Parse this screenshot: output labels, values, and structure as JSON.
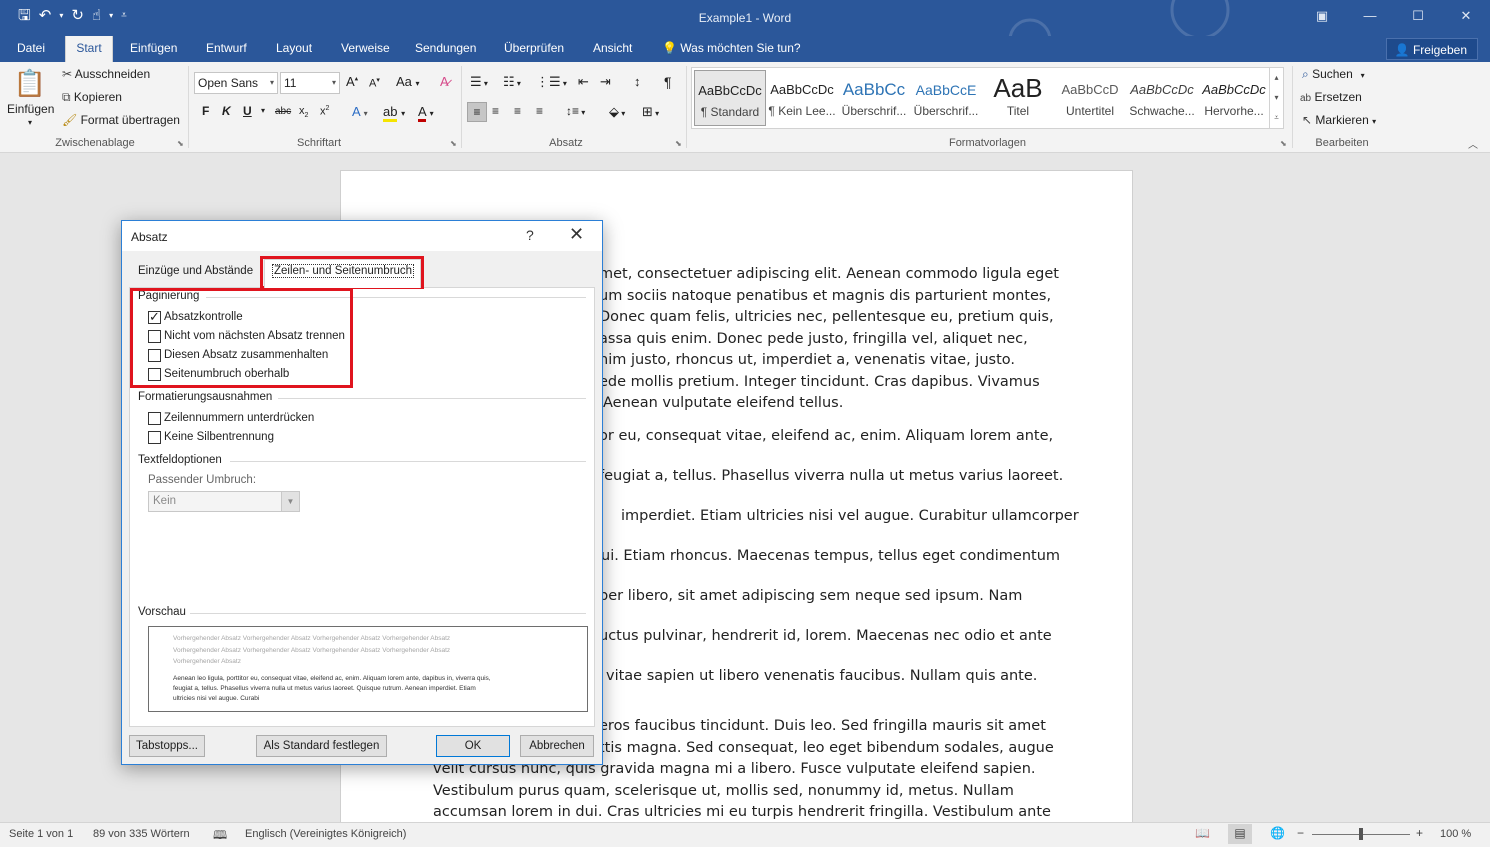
{
  "window": {
    "title": "Example1 - Word",
    "share_label": "Freigeben"
  },
  "tabs": [
    {
      "label": "Datei"
    },
    {
      "label": "Start"
    },
    {
      "label": "Einfügen"
    },
    {
      "label": "Entwurf"
    },
    {
      "label": "Layout"
    },
    {
      "label": "Verweise"
    },
    {
      "label": "Sendungen"
    },
    {
      "label": "Überprüfen"
    },
    {
      "label": "Ansicht"
    },
    {
      "label": "Was möchten Sie tun?"
    }
  ],
  "ribbon": {
    "clipboard": {
      "label": "Zwischenablage",
      "paste": "Einfügen",
      "cut": "Ausschneiden",
      "copy": "Kopieren",
      "format_painter": "Format übertragen"
    },
    "font": {
      "label": "Schriftart",
      "family": "Open Sans",
      "size": "11"
    },
    "paragraph": {
      "label": "Absatz"
    },
    "styles": {
      "label": "Formatvorlagen",
      "items": [
        {
          "sample": "AaBbCcDc",
          "name": "¶ Standard"
        },
        {
          "sample": "AaBbCcDc",
          "name": "¶ Kein Lee..."
        },
        {
          "sample": "AaBbCc",
          "name": "Überschrif..."
        },
        {
          "sample": "AaBbCcE",
          "name": "Überschrif..."
        },
        {
          "sample": "AaB",
          "name": "Titel"
        },
        {
          "sample": "AaBbCcD",
          "name": "Untertitel"
        },
        {
          "sample": "AaBbCcDc",
          "name": "Schwache..."
        },
        {
          "sample": "AaBbCcDc",
          "name": "Hervorhe..."
        }
      ]
    },
    "editing": {
      "label": "Bearbeiten",
      "find": "Suchen",
      "replace": "Ersetzen",
      "select": "Markieren"
    }
  },
  "document": {
    "lines": [
      "met, consectetuer adipiscing elit. Aenean commodo ligula eget",
      "um sociis natoque penatibus et magnis dis parturient montes,",
      "Donec quam felis, ultricies nec, pellentesque eu, pretium quis,",
      "assa quis enim. Donec pede justo, fringilla vel, aliquet nec,",
      "nim justo, rhoncus ut, imperdiet a, venenatis vitae, justo.",
      "ede mollis pretium. Integer tincidunt. Cras dapibus. Vivamus",
      "Aenean vulputate eleifend tellus.",
      "or eu, consequat vitae, eleifend ac, enim. Aliquam lorem ante,",
      "feugiat a, tellus. Phasellus viverra nulla ut metus varius laoreet.",
      "imperdiet. Etiam ultricies nisi vel augue. Curabitur ullamcorper",
      "ui. Etiam rhoncus. Maecenas tempus, tellus eget condimentum",
      "per libero, sit amet adipiscing sem neque sed ipsum. Nam",
      "uctus pulvinar, hendrerit id, lorem. Maecenas nec odio et ante",
      "vitae sapien ut libero venenatis faucibus. Nullam quis ante.",
      "eros faucibus tincidunt. Duis leo. Sed fringilla mauris sit amet",
      "ttis magna. Sed consequat, leo eget bibendum sodales, augue",
      "velit cursus nunc, quis gravida magna mi a libero. Fusce vulputate eleifend sapien.",
      "Vestibulum purus quam, scelerisque ut, mollis sed, nonummy id, metus. Nullam",
      "accumsan lorem in dui. Cras ultricies mi eu turpis hendrerit fringilla. Vestibulum ante"
    ]
  },
  "statusbar": {
    "page": "Seite 1 von 1",
    "words": "89 von 335 Wörtern",
    "language": "Englisch (Vereinigtes Königreich)",
    "zoom": "100 %"
  },
  "dialog": {
    "title": "Absatz",
    "help": "?",
    "tab_indents": "Einzüge und Abstände",
    "tab_breaks": "Zeilen- und Seitenumbruch",
    "pagination_label": "Paginierung",
    "pagination": [
      {
        "label": "Absatzkontrolle",
        "checked": true
      },
      {
        "label": "Nicht vom nächsten Absatz trennen",
        "checked": false
      },
      {
        "label": "Diesen Absatz zusammenhalten",
        "checked": false
      },
      {
        "label": "Seitenumbruch oberhalb",
        "checked": false
      }
    ],
    "formatting_label": "Formatierungsausnahmen",
    "formatting": [
      {
        "label": "Zeilennummern unterdrücken",
        "checked": false
      },
      {
        "label": "Keine Silbentrennung",
        "checked": false
      }
    ],
    "textbox_label": "Textfeldoptionen",
    "wrap_label": "Passender Umbruch:",
    "wrap_value": "Kein",
    "preview_label": "Vorschau",
    "preview_prev": [
      "Vorhergehender Absatz Vorhergehender Absatz Vorhergehender Absatz Vorhergehender Absatz",
      "Vorhergehender Absatz Vorhergehender Absatz Vorhergehender Absatz Vorhergehender Absatz",
      "Vorhergehender Absatz"
    ],
    "preview_current": [
      "Aenean leo ligula, porttitor eu, consequat vitae, eleifend ac, enim. Aliquam lorem ante, dapibus in, viverra quis,",
      "feugiat a, tellus. Phasellus viverra nulla ut metus varius laoreet. Quisque rutrum. Aenean imperdiet. Etiam",
      "ultricies nisi vel augue. Curabi"
    ],
    "btn_tabs": "Tabstopps...",
    "btn_default": "Als Standard festlegen",
    "btn_ok": "OK",
    "btn_cancel": "Abbrechen"
  },
  "colors": {
    "word_blue": "#2b579a",
    "highlight_red": "#e0141e"
  }
}
